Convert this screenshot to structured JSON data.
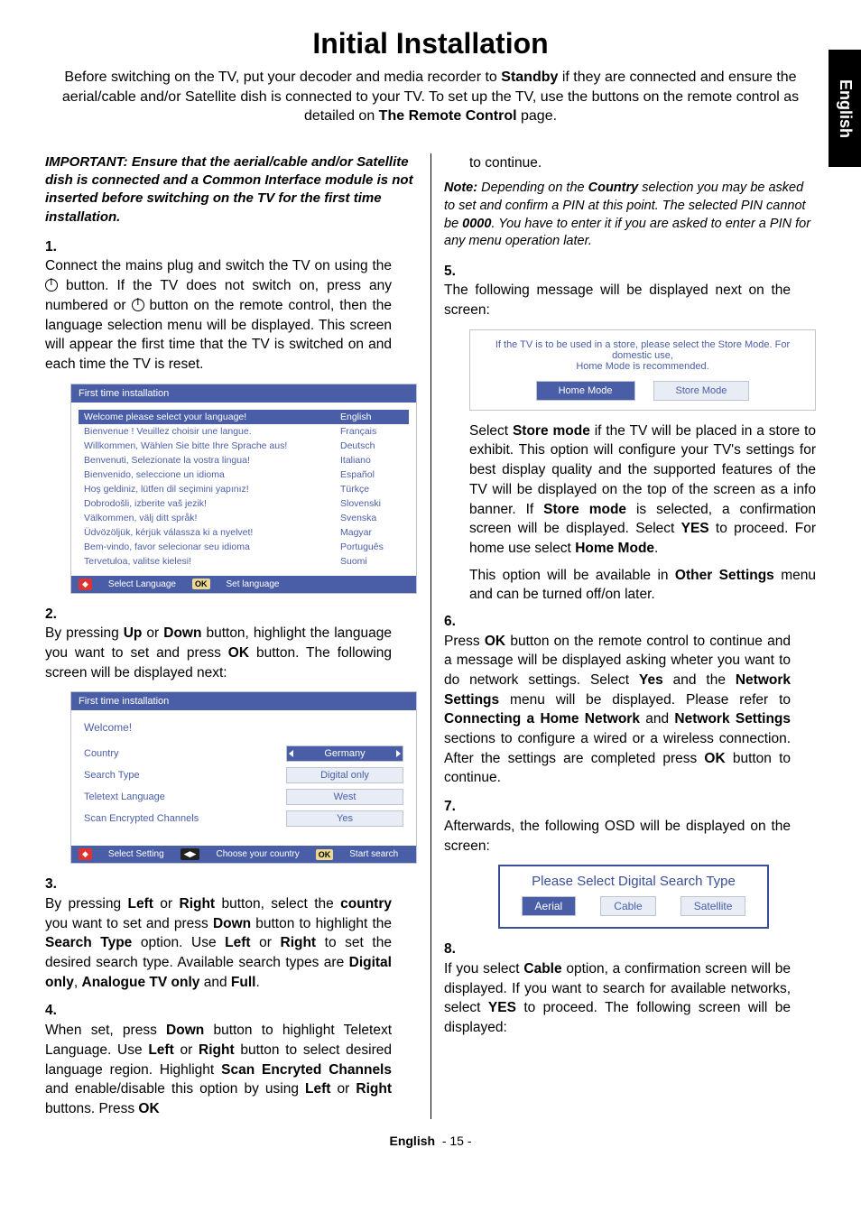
{
  "sideTab": "English",
  "title": "Initial Installation",
  "intro": {
    "p1a": "Before switching on the TV, put your decoder and media recorder to ",
    "p1b": "Standby",
    "p1c": " if they are connected and ensure the aerial/cable and/or Satellite dish is connected to your TV. To set up the TV, use the buttons on the remote control as detailed on ",
    "p1d": "The Remote Control",
    "p1e": " page."
  },
  "important": "IMPORTANT: Ensure that the aerial/cable and/or Satellite dish is connected and a Common Interface module is not inserted before switching on the TV for the first time installation.",
  "steps": {
    "s1a": "Connect the mains plug and switch the TV on using the ",
    "s1b": " button. If the TV does not switch on, press any numbered or ",
    "s1c": " button on the remote control, then the language selection menu will be displayed. This screen will appear the first time that the TV is switched on and each time the TV is reset.",
    "s2a": "By pressing ",
    "s2b": "Up",
    "s2c": " or ",
    "s2d": "Down",
    "s2e": " button, highlight the language you want to set and press ",
    "s2f": "OK",
    "s2g": " button. The following screen will be displayed next:",
    "s3a": "By pressing ",
    "s3b": "Left",
    "s3c": " or ",
    "s3d": "Right",
    "s3e": " button, select the ",
    "s3f": "country",
    "s3g": " you want to set and press ",
    "s3h": "Down",
    "s3i": " button to highlight the ",
    "s3j": "Search Type",
    "s3k": " option. Use ",
    "s3l": "Left",
    "s3m": " or ",
    "s3n": "Right",
    "s3o": " to set the desired search type. Available search types are ",
    "s3p": "Digital only",
    "s3q": ", ",
    "s3r": "Analogue TV only",
    "s3s": " and ",
    "s3t": "Full",
    "s3u": ".",
    "s4a": "When set, press ",
    "s4b": "Down",
    "s4c": " button to highlight Teletext Language. Use ",
    "s4d": "Left",
    "s4e": " or ",
    "s4f": "Right",
    "s4g": " button to select desired language region. Highlight ",
    "s4h": "Scan Encryted Channels",
    "s4i": " and enable/disable this option by using ",
    "s4j": "Left",
    "s4k": " or ",
    "s4l": "Right",
    "s4m": " buttons. Press ",
    "s4n": "OK",
    "s4cont": "to continue.",
    "notea": "Note:",
    "noteb": " Depending on the ",
    "notec": "Country",
    "noted": " selection you may be asked to set and confirm a PIN at this point. The selected PIN cannot be ",
    "notee": "0000",
    "notef": ". You have to enter it if you are asked to enter a PIN for any menu operation later.",
    "s5": "The following message will be displayed next on the screen:",
    "s5ca": "Select ",
    "s5cb": "Store mode",
    "s5cc": " if the TV will be placed in a store to exhibit. This option will configure your TV's settings for best display quality and the supported features of the TV will be displayed on the top of the screen as a info banner. If ",
    "s5cd": "Store mode",
    "s5ce": " is selected, a confirmation screen will be displayed. Select ",
    "s5cf": "YES",
    "s5cg": " to proceed. For home use select ",
    "s5ch": "Home Mode",
    "s5ci": ".",
    "s5cja": "This option will be available in ",
    "s5cjb": "Other Settings",
    "s5cjc": " menu and can be turned off/on later.",
    "s6a": "Press ",
    "s6b": "OK",
    "s6c": " button on the remote control to continue and a message will be displayed asking wheter you want to do network settings. Select ",
    "s6d": "Yes",
    "s6e": " and the ",
    "s6f": "Network Settings",
    "s6g": " menu will be displayed. Please refer to ",
    "s6h": "Connecting a Home Network",
    "s6i": " and ",
    "s6j": "Network Settings",
    "s6k": " sections to configure a wired or a wireless connection. After the settings are completed press ",
    "s6l": "OK",
    "s6m": " button to continue.",
    "s7": "Afterwards, the following OSD will be displayed on the screen:",
    "s8a": "If you select ",
    "s8b": "Cable",
    "s8c": " option, a confirmation screen will be displayed. If you want to search for available networks, select ",
    "s8d": "YES",
    "s8e": " to proceed. The following screen will be displayed:"
  },
  "fig1": {
    "title": "First time installation",
    "rows": [
      {
        "l": "Welcome please select your language!",
        "r": "English",
        "sel": true
      },
      {
        "l": "Bienvenue ! Veuillez choisir une langue.",
        "r": "Français"
      },
      {
        "l": "Willkommen, Wählen Sie bitte Ihre Sprache aus!",
        "r": "Deutsch"
      },
      {
        "l": "Benvenuti, Selezionate la vostra lingua!",
        "r": "Italiano"
      },
      {
        "l": "Bienvenido, seleccione un idioma",
        "r": "Español"
      },
      {
        "l": "Hoş geldiniz, lütfen dil seçimini yapınız!",
        "r": "Türkçe"
      },
      {
        "l": "Dobrodošli, izberite vaš jezik!",
        "r": "Slovenski"
      },
      {
        "l": "Välkommen, välj ditt språk!",
        "r": "Svenska"
      },
      {
        "l": "Üdvözöljük, kérjük válassza ki a nyelvet!",
        "r": "Magyar"
      },
      {
        "l": "Bem-vindo, favor selecionar seu idioma",
        "r": "Português"
      },
      {
        "l": "Tervetuloa, valitse kielesi!",
        "r": "Suomi"
      }
    ],
    "footer1": "Select Language",
    "footer2": "Set language"
  },
  "fig2": {
    "title": "First time installation",
    "welcome": "Welcome!",
    "rows": [
      {
        "l": "Country",
        "r": "Germany",
        "sel": true
      },
      {
        "l": "Search Type",
        "r": "Digital only"
      },
      {
        "l": "Teletext Language",
        "r": "West"
      },
      {
        "l": "Scan Encrypted Channels",
        "r": "Yes"
      }
    ],
    "footer1": "Select Setting",
    "footer2": "Choose your country",
    "footer3": "Start search"
  },
  "fig3": {
    "line1": "If the TV is to be used in a store, please select the Store Mode. For domestic use,",
    "line2": "Home Mode is recommended.",
    "b1": "Home Mode",
    "b2": "Store Mode"
  },
  "fig4": {
    "title": "Please Select Digital Search Type",
    "b1": "Aerial",
    "b2": "Cable",
    "b3": "Satellite"
  },
  "footer": {
    "label": "English",
    "page": "- 15 -"
  }
}
